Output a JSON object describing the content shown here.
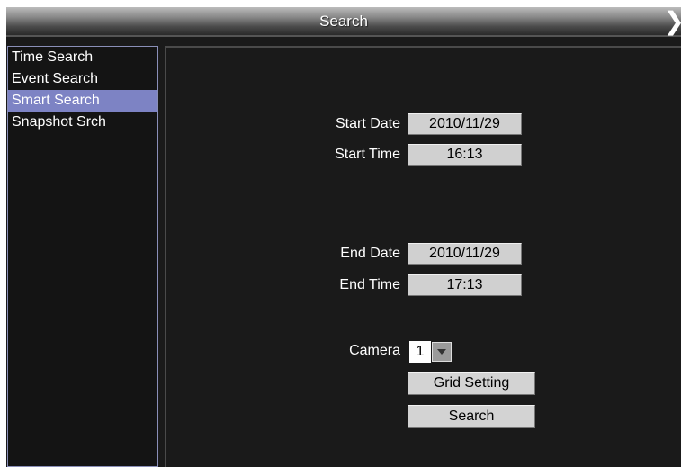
{
  "window": {
    "title": "Search",
    "close_icon": "chevron-right-icon"
  },
  "sidebar": {
    "items": [
      {
        "label": "Time Search",
        "selected": false
      },
      {
        "label": "Event Search",
        "selected": false
      },
      {
        "label": "Smart Search",
        "selected": true
      },
      {
        "label": "Snapshot Srch",
        "selected": false
      }
    ],
    "selected_color": "#7d83c4"
  },
  "form": {
    "start_date_label": "Start Date",
    "start_date_value": "2010/11/29",
    "start_time_label": "Start Time",
    "start_time_value": "16:13",
    "end_date_label": "End Date",
    "end_date_value": "2010/11/29",
    "end_time_label": "End Time",
    "end_time_value": "17:13",
    "camera_label": "Camera",
    "camera_value": "1",
    "camera_dropdown_icon": "dropdown-arrow-icon",
    "grid_setting_label": "Grid Setting",
    "search_label": "Search"
  }
}
